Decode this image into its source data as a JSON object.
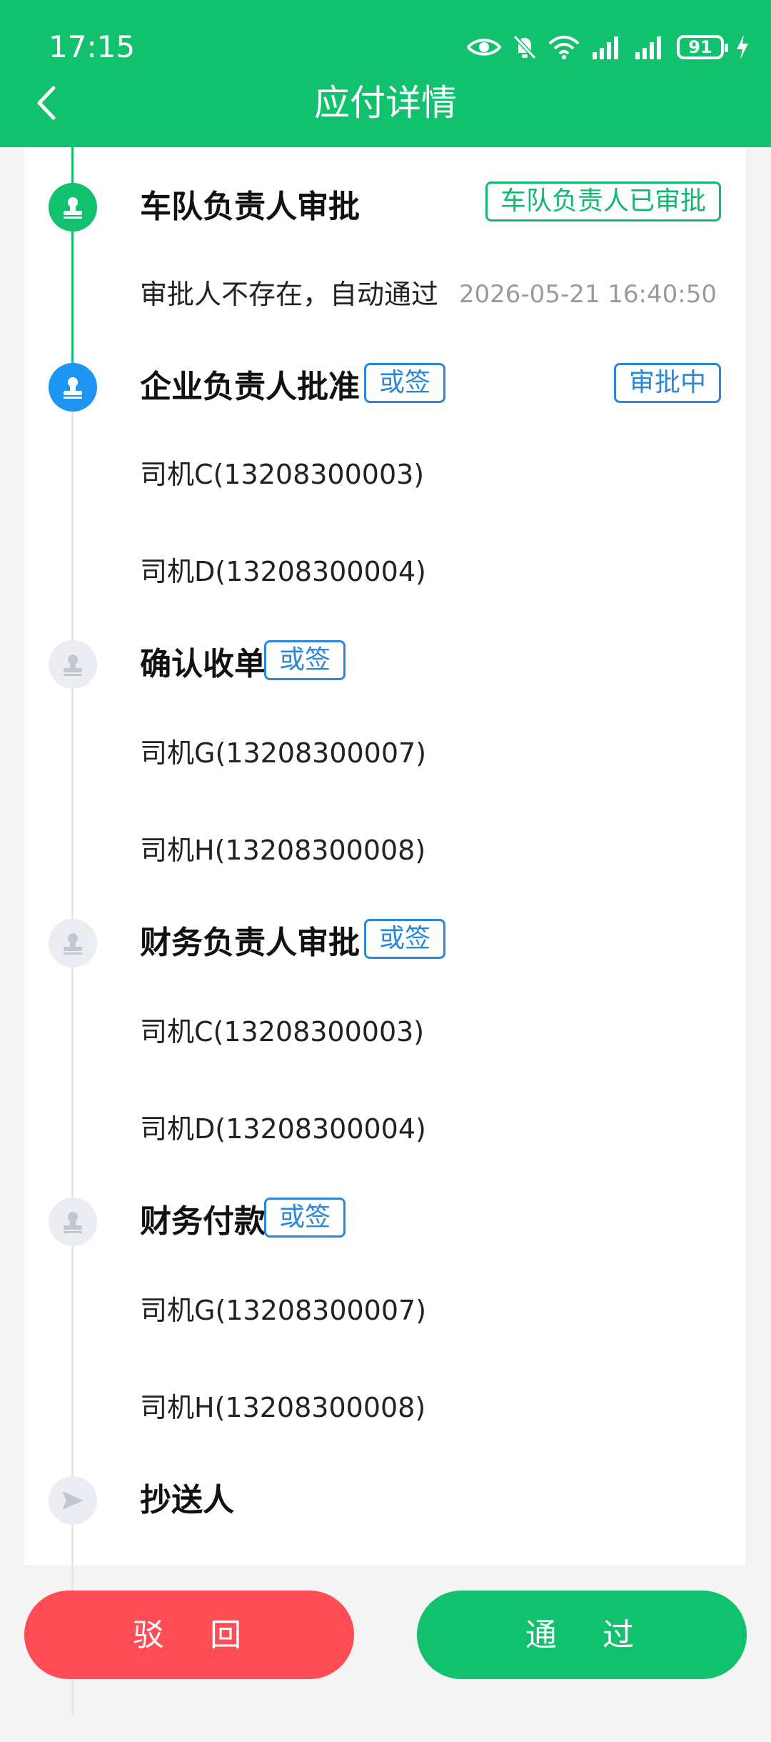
{
  "status_bar": {
    "time": "17:15",
    "battery": "91"
  },
  "header": {
    "title": "应付详情"
  },
  "steps": [
    {
      "title": "车队负责人审批",
      "status": "车队负责人已审批",
      "note": "审批人不存在，自动通过",
      "time": "2026-05-21 16:40:50"
    },
    {
      "title": "企业负责人批准",
      "tag": "或签",
      "status": "审批中",
      "people": [
        "司机C(13208300003)",
        "司机D(13208300004)"
      ]
    },
    {
      "title": "确认收单",
      "tag": "或签",
      "people": [
        "司机G(13208300007)",
        "司机H(13208300008)"
      ]
    },
    {
      "title": "财务负责人审批",
      "tag": "或签",
      "people": [
        "司机C(13208300003)",
        "司机D(13208300004)"
      ]
    },
    {
      "title": "财务付款",
      "tag": "或签",
      "people": [
        "司机G(13208300007)",
        "司机H(13208300008)"
      ]
    },
    {
      "title": "抄送人"
    }
  ],
  "actions": {
    "reject": "驳 回",
    "pass": "通 过"
  },
  "colors": {
    "brand": "#12c16e",
    "active": "#1c96f2",
    "reject": "#ff4c55",
    "tag_blue": "#2b87d8"
  }
}
